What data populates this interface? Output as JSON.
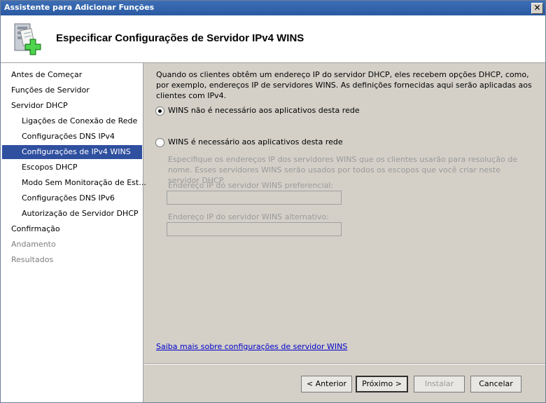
{
  "window": {
    "title": "Assistente para Adicionar Funções",
    "close_glyph": "✕"
  },
  "header": {
    "title": "Especificar Configurações de Servidor IPv4 WINS",
    "icon": "server-add-icon"
  },
  "nav": {
    "items": [
      {
        "label": "Antes de Começar"
      },
      {
        "label": "Funções de Servidor"
      },
      {
        "label": "Servidor DHCP"
      },
      {
        "label": "Ligações de Conexão de Rede"
      },
      {
        "label": "Configurações DNS IPv4"
      },
      {
        "label": "Configurações de IPv4 WINS"
      },
      {
        "label": "Escopos DHCP"
      },
      {
        "label": "Modo Sem Monitoração de Est..."
      },
      {
        "label": "Configurações DNS IPv6"
      },
      {
        "label": "Autorização de Servidor DHCP"
      },
      {
        "label": "Confirmação"
      },
      {
        "label": "Andamento"
      },
      {
        "label": "Resultados"
      }
    ]
  },
  "content": {
    "description": "Quando os clientes obtêm um endereço IP do servidor DHCP, eles recebem opções DHCP, como, por exemplo, endereços IP de servidores WINS. As definições fornecidas aqui serão aplicadas aos clientes com IPv4.",
    "option_not_required": "WINS não é necessário aos aplicativos desta rede",
    "option_required": "WINS é necessário aos aplicativos desta rede",
    "required_desc": "Especifique os endereços IP dos servidores WINS que os clientes usarão para resolução de nome. Esses servidores WINS serão usados por todos os escopos que você criar neste servidor DHCP.",
    "preferred_label": "Endereço IP do servidor WINS preferencial:",
    "preferred_value": "",
    "alternate_label": "Endereço IP do servidor WINS alternativo:",
    "alternate_value": "",
    "link": "Saiba mais sobre configurações de servidor WINS"
  },
  "buttons": {
    "back": "< Anterior",
    "next": "Próximo >",
    "install": "Instalar",
    "cancel": "Cancelar"
  },
  "colors": {
    "title_bar": "#2a59a2",
    "selected_nav": "#2f4f9f",
    "link": "#0000cc"
  }
}
